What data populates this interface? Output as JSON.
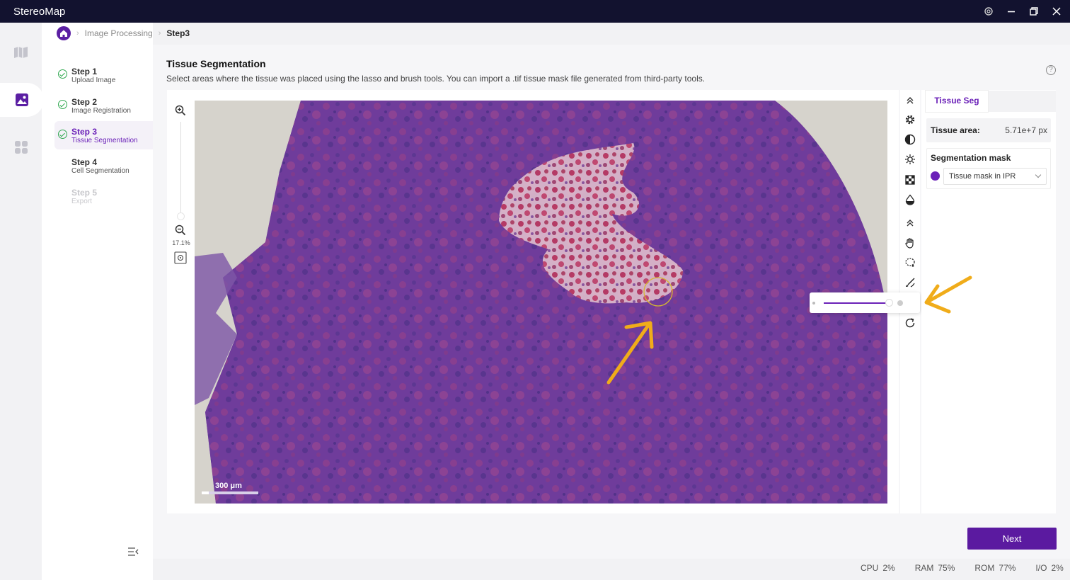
{
  "app": {
    "title": "StereoMap"
  },
  "breadcrumb": {
    "items": [
      "Image Processing"
    ],
    "current": "Step3"
  },
  "steps": [
    {
      "title": "Step 1",
      "subtitle": "Upload Image",
      "state": "done"
    },
    {
      "title": "Step 2",
      "subtitle": "Image Registration",
      "state": "done"
    },
    {
      "title": "Step 3",
      "subtitle": "Tissue Segmentation",
      "state": "active"
    },
    {
      "title": "Step 4",
      "subtitle": "Cell Segmentation",
      "state": "pending"
    },
    {
      "title": "Step 5",
      "subtitle": "Export",
      "state": "disabled"
    }
  ],
  "page": {
    "title": "Tissue Segmentation",
    "description": "Select areas where the tissue was placed using the lasso and brush tools. You can import a .tif tissue mask file generated from third-party tools."
  },
  "viewer": {
    "zoom_percent": "17.1%",
    "scale_label": "300 μm",
    "brush_size_fraction": 0.92
  },
  "tools": [
    "collapse-up-icon",
    "settings-gear-icon",
    "contrast-icon",
    "brightness-icon",
    "grid-icon",
    "saturation-drop-icon",
    "collapse-up-icon",
    "hand-pan-icon",
    "lasso-icon",
    "brush-icon",
    "eraser-icon",
    "reset-icon"
  ],
  "side_panel": {
    "tab": "Tissue Seg",
    "tissue_area_label": "Tissue area:",
    "tissue_area_value": "5.71e+7 px",
    "mask_title": "Segmentation mask",
    "mask_selected": "Tissue mask in IPR"
  },
  "actions": {
    "next_label": "Next"
  },
  "status": {
    "cpu_label": "CPU",
    "cpu_value": "2%",
    "ram_label": "RAM",
    "ram_value": "75%",
    "rom_label": "ROM",
    "rom_value": "77%",
    "io_label": "I/O",
    "io_value": "2%"
  },
  "colors": {
    "accent": "#6b21b8",
    "titlebar": "#12122f",
    "annotation": "#f0ac1a",
    "mask": "#6a1fa8"
  }
}
